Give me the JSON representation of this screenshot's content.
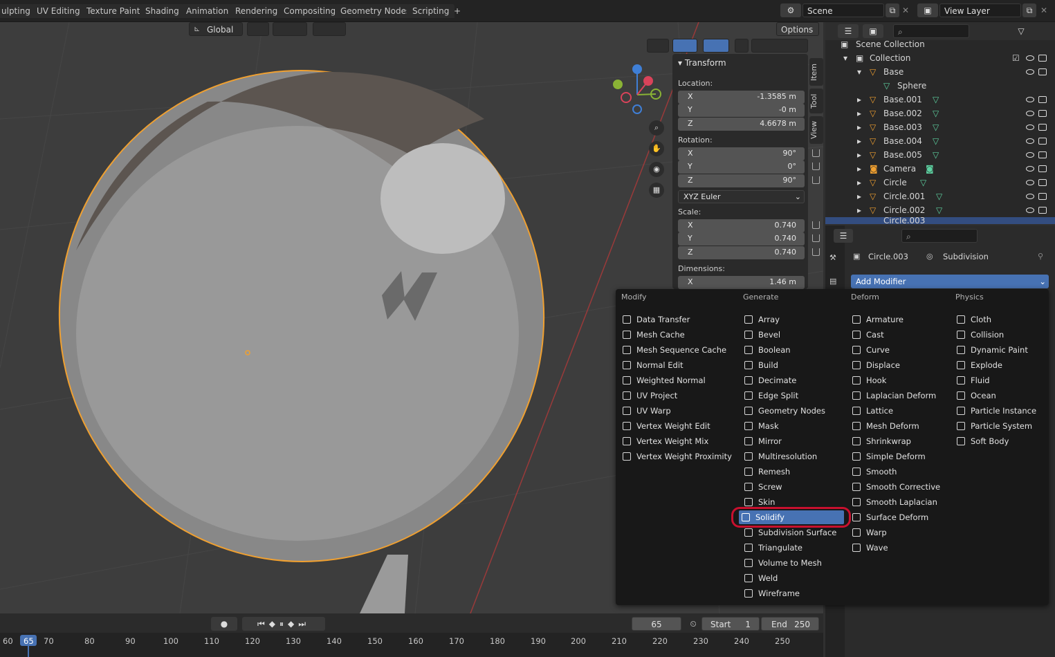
{
  "workspace_tabs": [
    "ulpting",
    "UV Editing",
    "Texture Paint",
    "Shading",
    "Animation",
    "Rendering",
    "Compositing",
    "Geometry Nodes",
    "Scripting"
  ],
  "scene_label": "Scene",
  "view_layer_label": "View Layer",
  "viewport_header": {
    "orientation": "Global",
    "options_label": "Options"
  },
  "npanel": {
    "tab_item": "Item",
    "tab_tool": "Tool",
    "tab_view": "View",
    "title": "Transform",
    "location_label": "Location:",
    "location": [
      {
        "axis": "X",
        "value": "-1.3585 m"
      },
      {
        "axis": "Y",
        "value": "-0 m"
      },
      {
        "axis": "Z",
        "value": "4.6678 m"
      }
    ],
    "rotation_label": "Rotation:",
    "rotation": [
      {
        "axis": "X",
        "value": "90°"
      },
      {
        "axis": "Y",
        "value": "0°"
      },
      {
        "axis": "Z",
        "value": "90°"
      }
    ],
    "rotation_mode": "XYZ Euler",
    "scale_label": "Scale:",
    "scale": [
      {
        "axis": "X",
        "value": "0.740"
      },
      {
        "axis": "Y",
        "value": "0.740"
      },
      {
        "axis": "Z",
        "value": "0.740"
      }
    ],
    "dimensions_label": "Dimensions:",
    "dimensions_x": {
      "axis": "X",
      "value": "1.46 m"
    }
  },
  "outliner": {
    "scene_collection": "Scene Collection",
    "collection": "Collection",
    "items": [
      "Base",
      "Sphere",
      "Base.001",
      "Base.002",
      "Base.003",
      "Base.004",
      "Base.005",
      "Camera",
      "Circle",
      "Circle.001",
      "Circle.002",
      "Circle.003"
    ]
  },
  "properties": {
    "object_name": "Circle.003",
    "modifier_name": "Subdivision",
    "add_modifier_label": "Add Modifier"
  },
  "menu": {
    "columns": [
      {
        "title": "Modify",
        "items": [
          "Data Transfer",
          "Mesh Cache",
          "Mesh Sequence Cache",
          "Normal Edit",
          "Weighted Normal",
          "UV Project",
          "UV Warp",
          "Vertex Weight Edit",
          "Vertex Weight Mix",
          "Vertex Weight Proximity"
        ]
      },
      {
        "title": "Generate",
        "items": [
          "Array",
          "Bevel",
          "Boolean",
          "Build",
          "Decimate",
          "Edge Split",
          "Geometry Nodes",
          "Mask",
          "Mirror",
          "Multiresolution",
          "Remesh",
          "Screw",
          "Skin",
          "Solidify",
          "Subdivision Surface",
          "Triangulate",
          "Volume to Mesh",
          "Weld",
          "Wireframe"
        ]
      },
      {
        "title": "Deform",
        "items": [
          "Armature",
          "Cast",
          "Curve",
          "Displace",
          "Hook",
          "Laplacian Deform",
          "Lattice",
          "Mesh Deform",
          "Shrinkwrap",
          "Simple Deform",
          "Smooth",
          "Smooth Corrective",
          "Smooth Laplacian",
          "Surface Deform",
          "Warp",
          "Wave"
        ]
      },
      {
        "title": "Physics",
        "items": [
          "Cloth",
          "Collision",
          "Dynamic Paint",
          "Explode",
          "Fluid",
          "Ocean",
          "Particle Instance",
          "Particle System",
          "Soft Body"
        ]
      }
    ],
    "selected": "Solidify"
  },
  "timeline": {
    "current_frame": "65",
    "start_label": "Start",
    "start": "1",
    "end_label": "End",
    "end": "250",
    "ruler": [
      "60",
      "65",
      "70",
      "80",
      "90",
      "100",
      "110",
      "120",
      "130",
      "140",
      "150",
      "160",
      "170",
      "180",
      "190",
      "200",
      "210",
      "220",
      "230",
      "240",
      "250"
    ]
  },
  "colors": {
    "accent": "#4772b3",
    "selection_outline": "#f0a030",
    "highlight_ring": "#c8102e"
  }
}
